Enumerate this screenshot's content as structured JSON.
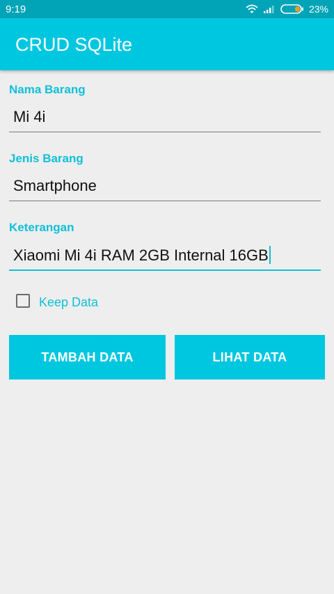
{
  "status_bar": {
    "time": "9:19",
    "battery_percent": "23%",
    "icons": [
      "wifi-icon",
      "signal-icon",
      "battery-icon"
    ]
  },
  "app_bar": {
    "title": "CRUD SQLite"
  },
  "form": {
    "nama_barang": {
      "label": "Nama Barang",
      "value": "Mi 4i"
    },
    "jenis_barang": {
      "label": "Jenis Barang",
      "value": "Smartphone"
    },
    "keterangan": {
      "label": "Keterangan",
      "value": "Xiaomi Mi 4i RAM 2GB Internal 16GB"
    },
    "keep_data": {
      "label": "Keep Data",
      "checked": false
    }
  },
  "buttons": {
    "tambah": "TAMBAH DATA",
    "lihat": "LIHAT DATA"
  },
  "colors": {
    "accent": "#10c0d8",
    "app_bar": "#00c7e0",
    "status_bar": "#00a4b6",
    "background": "#eeeeee"
  }
}
